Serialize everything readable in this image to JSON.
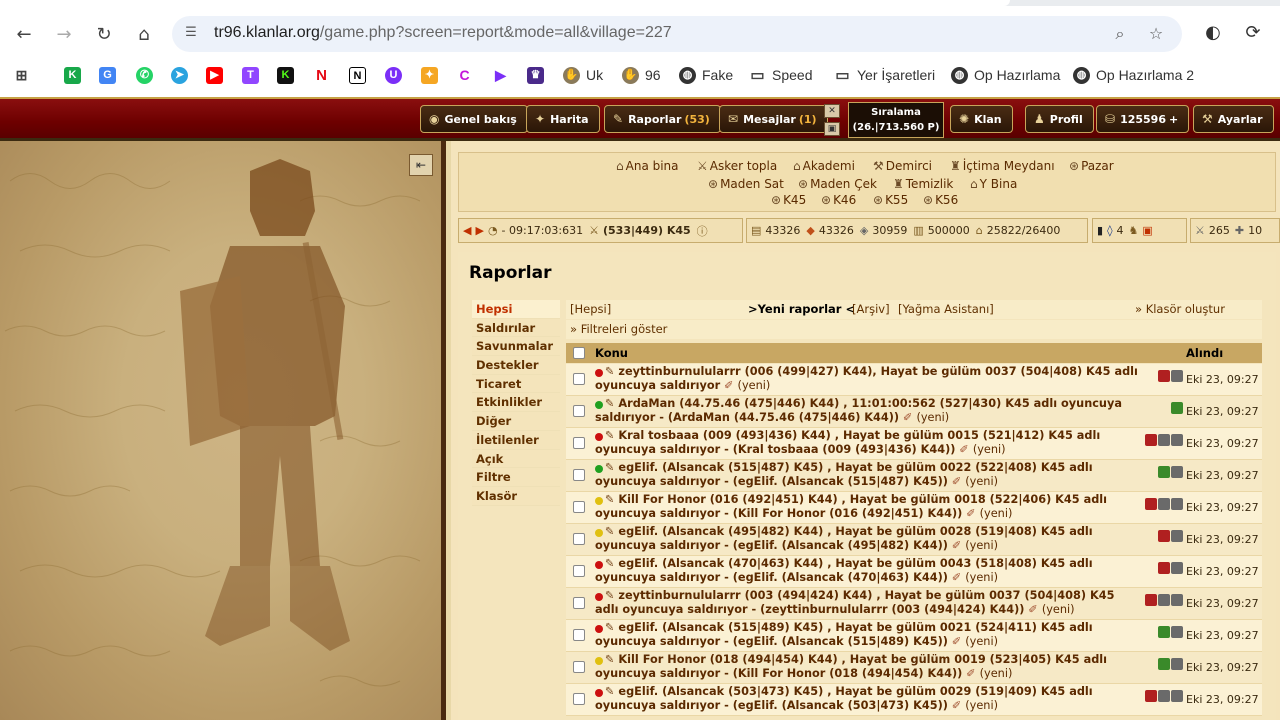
{
  "browser": {
    "url_host": "tr96.klanlar.org",
    "url_path": "/game.php?screen=report&mode=all&village=227",
    "bookmarks": [
      {
        "label": "Uk",
        "icon": "hand-icon"
      },
      {
        "label": "96",
        "icon": "hand-icon"
      },
      {
        "label": "Fake",
        "icon": "globe-icon"
      },
      {
        "label": "Speed",
        "icon": "folder-icon"
      },
      {
        "label": "Yer İşaretleri",
        "icon": "folder-icon"
      },
      {
        "label": "Op Hazırlama",
        "icon": "globe-icon"
      },
      {
        "label": "Op Hazırlama 2",
        "icon": "globe-icon"
      }
    ]
  },
  "game_nav": {
    "overview": "Genel bakış",
    "map": "Harita",
    "reports": "Raporlar",
    "reports_count": "(53)",
    "messages": "Mesajlar",
    "messages_count": "(1)",
    "ranking_label": "Sıralama",
    "ranking_value": "(26.|713.560 P)",
    "clan": "Klan",
    "profile": "Profil",
    "premium_points": "125596",
    "settings": "Ayarlar"
  },
  "buildings": {
    "row1": [
      "Ana bina",
      "Asker topla",
      "Akademi",
      "Demirci",
      "İçtima Meydanı",
      "Pazar"
    ],
    "row2": [
      "Maden Sat",
      "Maden Çek",
      "Temizlik",
      "Y Bina"
    ],
    "row3": [
      "K45",
      "K46",
      "K55",
      "K56"
    ]
  },
  "resources": {
    "time": "- 09:17:03:631",
    "village": "(533|449) K45",
    "wood": "43326",
    "clay": "43326",
    "iron": "30959",
    "storage": "500000",
    "population": "25822/26400",
    "badge_count": "4",
    "attacks": "265",
    "supports": "10"
  },
  "page": {
    "title": "Raporlar",
    "menu": [
      "Hepsi",
      "Saldırılar",
      "Savunmalar",
      "Destekler",
      "Ticaret",
      "Etkinlikler",
      "Diğer",
      "İletilenler",
      "Açık",
      "Filtre",
      "Klasör"
    ],
    "subnav_all": "[Hepsi]",
    "subnav_new": ">Yeni raporlar <",
    "subnav_archive": "[Arşiv]",
    "subnav_loot": "[Yağma Asistanı]",
    "create_folder": "» Klasör oluştur",
    "show_filters": "» Filtreleri göster",
    "col_subject": "Konu",
    "col_received": "Alındı"
  },
  "reports": [
    {
      "dot": "#cc1010",
      "text": "zeyttinburnulularrr (006 (499|427) K44), Hayat be gülüm 0037 (504|408) K45 adlı oyuncuya saldırıyor",
      "new": "(yeni)",
      "date": "Eki 23, 09:27"
    },
    {
      "dot": "#20a020",
      "text": "ArdaMan (44.75.46 (475|446) K44) , 11:01:00:562 (527|430) K45 adlı oyuncuya saldırıyor - (ArdaMan (44.75.46 (475|446) K44))",
      "new": "(yeni)",
      "date": "Eki 23, 09:27"
    },
    {
      "dot": "#cc1010",
      "text": "Kral tosbaaa (009 (493|436) K44) , Hayat be gülüm 0015 (521|412) K45 adlı oyuncuya saldırıyor - (Kral tosbaaa (009 (493|436) K44))",
      "new": "(yeni)",
      "date": "Eki 23, 09:27"
    },
    {
      "dot": "#20a020",
      "text": "egElif. (Alsancak (515|487) K45) , Hayat be gülüm 0022 (522|408) K45 adlı oyuncuya saldırıyor - (egElif. (Alsancak (515|487) K45))",
      "new": "(yeni)",
      "date": "Eki 23, 09:27"
    },
    {
      "dot": "#e0c010",
      "text": "Kill For Honor (016 (492|451) K44) , Hayat be gülüm 0018 (522|406) K45 adlı oyuncuya saldırıyor - (Kill For Honor (016 (492|451) K44))",
      "new": "(yeni)",
      "date": "Eki 23, 09:27"
    },
    {
      "dot": "#e0c010",
      "text": "egElif. (Alsancak (495|482) K44) , Hayat be gülüm 0028 (519|408) K45 adlı oyuncuya saldırıyor - (egElif. (Alsancak (495|482) K44))",
      "new": "(yeni)",
      "date": "Eki 23, 09:27"
    },
    {
      "dot": "#cc1010",
      "text": "egElif. (Alsancak (470|463) K44) , Hayat be gülüm 0043 (518|408) K45 adlı oyuncuya saldırıyor - (egElif. (Alsancak (470|463) K44))",
      "new": "(yeni)",
      "date": "Eki 23, 09:27"
    },
    {
      "dot": "#cc1010",
      "text": "zeyttinburnulularrr (003 (494|424) K44) , Hayat be gülüm 0037 (504|408) K45 adlı oyuncuya saldırıyor - (zeyttinburnulularrr (003 (494|424) K44))",
      "new": "(yeni)",
      "date": "Eki 23, 09:27"
    },
    {
      "dot": "#cc1010",
      "text": "egElif. (Alsancak (515|489) K45) , Hayat be gülüm 0021 (524|411) K45 adlı oyuncuya saldırıyor - (egElif. (Alsancak (515|489) K45))",
      "new": "(yeni)",
      "date": "Eki 23, 09:27"
    },
    {
      "dot": "#e0c010",
      "text": "Kill For Honor (018 (494|454) K44) , Hayat be gülüm 0019 (523|405) K45 adlı oyuncuya saldırıyor - (Kill For Honor (018 (494|454) K44))",
      "new": "(yeni)",
      "date": "Eki 23, 09:27"
    },
    {
      "dot": "#cc1010",
      "text": "egElif. (Alsancak (503|473) K45) , Hayat be gülüm 0029 (519|409) K45 adlı oyuncuya saldırıyor - (egElif. (Alsancak (503|473) K45))",
      "new": "(yeni)",
      "date": "Eki 23, 09:27"
    }
  ]
}
